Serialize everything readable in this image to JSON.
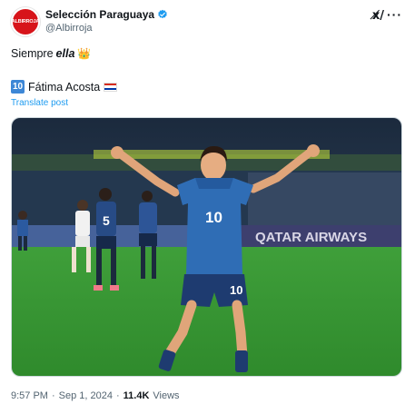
{
  "header": {
    "display_name": "Selección Paraguaya",
    "handle": "@Albirroja",
    "avatar_text": "ALBIRROJA"
  },
  "post": {
    "line1_prefix": "Siempre",
    "line1_emphasis": "ella",
    "number_badge": "10",
    "player_name": "Fátima Acosta",
    "translate_label": "Translate post"
  },
  "photo": {
    "jersey_number": "10",
    "shorts_number": "10",
    "teammate_number": "5",
    "banner_text": "QATAR AIRWAYS"
  },
  "meta": {
    "time": "9:57 PM",
    "separator": "·",
    "date": "Sep 1, 2024",
    "views_count": "11.4K",
    "views_label": "Views"
  },
  "colors": {
    "accent": "#1d9bf0",
    "avatar_red": "#d7141a",
    "verified_blue": "#1d9bf0",
    "jersey_blue": "#2f6db5"
  },
  "icons": [
    "verified-badge-icon",
    "grok-icon",
    "more-icon",
    "crown-icon",
    "paraguay-flag-icon"
  ]
}
